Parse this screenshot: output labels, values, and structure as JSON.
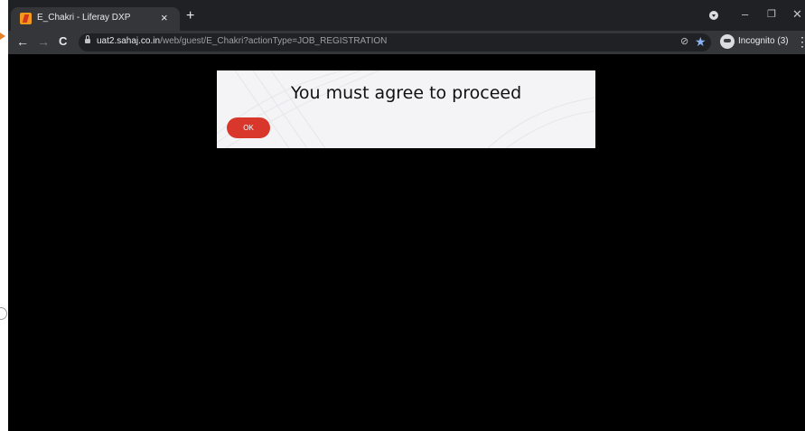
{
  "browser": {
    "tab_title": "E_Chakri - Liferay DXP",
    "tab_close": "×",
    "new_tab": "+",
    "url_host": "uat2.sahaj.co.in",
    "url_path": "/web/guest/E_Chakri?actionType=JOB_REGISTRATION",
    "incognito_label": "Incognito (3)",
    "back": "←",
    "forward": "→",
    "reload": "C",
    "minimize": "–",
    "restore": "❐",
    "close": "✕",
    "menu": "⋮",
    "star": "★",
    "eye_off": "⊘",
    "accent": "#8ab4f8"
  },
  "modal": {
    "title": "You must agree to proceed",
    "ok_label": "OK",
    "ok_color": "#d9372c"
  }
}
